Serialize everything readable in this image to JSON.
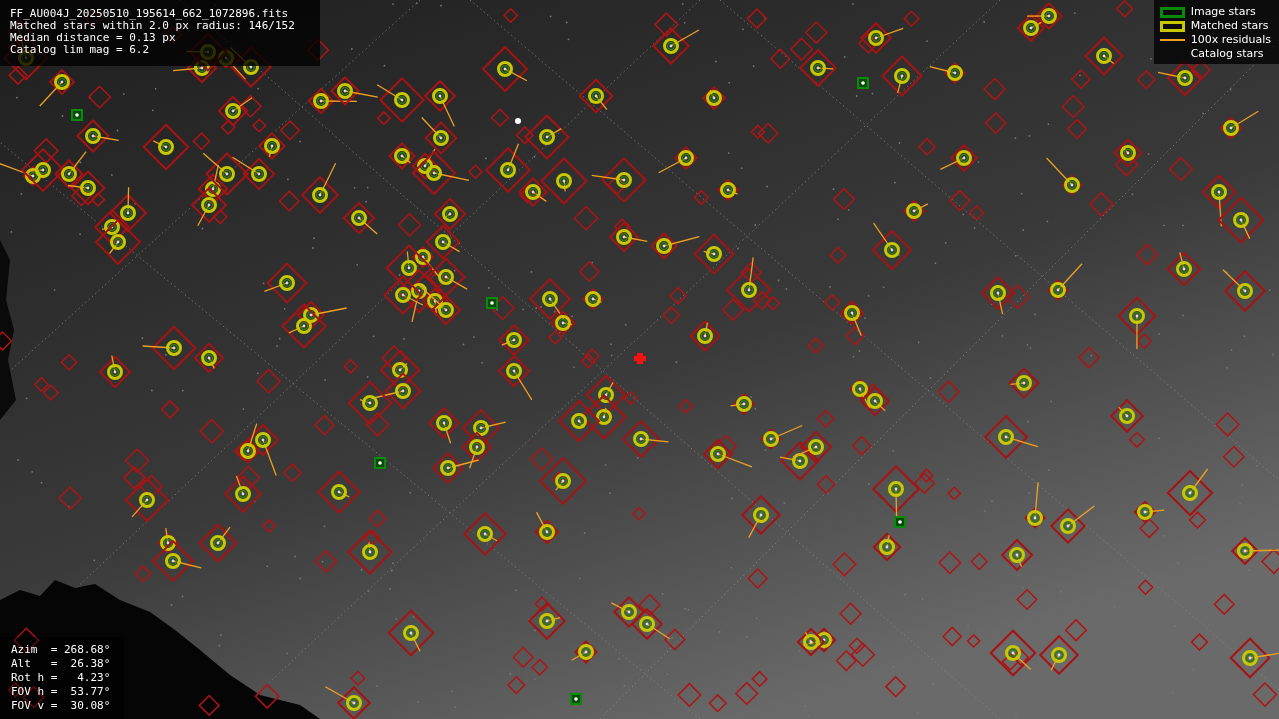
{
  "info": [
    "FF_AU004J_20250510_195614_662_1072896.fits",
    "Matched stars within 2.0 px radius: 146/152",
    "Median distance = 0.13 px",
    "Catalog lim mag = 6.2"
  ],
  "legend": [
    {
      "kind": "box",
      "label": "Image stars",
      "color": "#0a8a0a"
    },
    {
      "kind": "box",
      "label": "Matched stars",
      "color": "#c8c800"
    },
    {
      "kind": "line",
      "label": "100x residuals",
      "color": "#f0a020"
    },
    {
      "kind": "none",
      "label": "Catalog stars"
    }
  ],
  "pointing": [
    "Azim  = 268.68°",
    "Alt   =  26.38°",
    "Rot h =   4.23°",
    "FOV h =  53.77°",
    "FOV v =  30.08°"
  ]
}
